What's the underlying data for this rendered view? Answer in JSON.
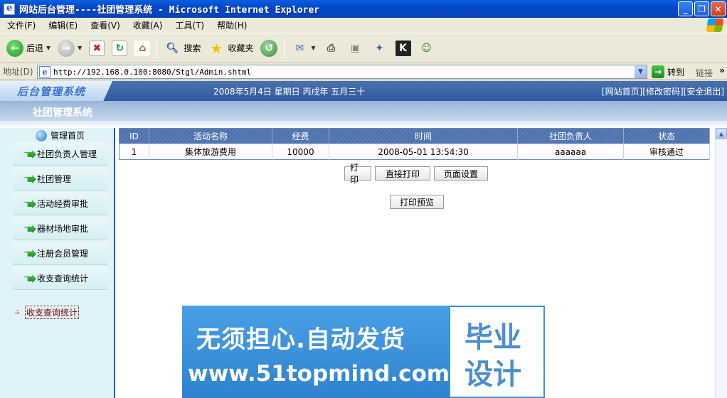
{
  "window": {
    "title": "网站后台管理----社团管理系统 - Microsoft Internet Explorer",
    "min_label": "_",
    "max_label": "❐",
    "close_label": "✕"
  },
  "menu": [
    "文件(F)",
    "编辑(E)",
    "查看(V)",
    "收藏(A)",
    "工具(T)",
    "帮助(H)"
  ],
  "toolbar": {
    "back_label": "后退",
    "search_label": "搜索",
    "favorites_label": "收藏夹"
  },
  "address": {
    "label": "地址(D)",
    "url": "http://192.168.0.100:8080/Stgl/Admin.shtml",
    "go_label": "转到",
    "links_label": "链接"
  },
  "site": {
    "logo": "后台管理系统",
    "date": "2008年5月4日 星期日 丙戌年 五月三十",
    "top_links": "[网站首页][修改密码][安全退出]",
    "subtitle": "社团管理系统"
  },
  "sidebar": {
    "home_label": "管理首页",
    "items": [
      {
        "label": "社团负责人管理"
      },
      {
        "label": "社团管理"
      },
      {
        "label": "活动经费审批"
      },
      {
        "label": "器材场地审批"
      },
      {
        "label": "注册会员管理"
      },
      {
        "label": "收支查询统计"
      }
    ],
    "active_label": "收支查询统计"
  },
  "table": {
    "headers": [
      "ID",
      "活动名称",
      "经费",
      "时间",
      "社团负责人",
      "状态"
    ],
    "rows": [
      [
        "1",
        "集体旅游费用",
        "10000",
        "2008-05-01 13:54:30",
        "aaaaaa",
        "审核通过"
      ]
    ]
  },
  "buttons": {
    "print": "打印",
    "direct_print": "直接打印",
    "page_setup": "页面设置",
    "print_preview": "打印预览"
  },
  "banner": {
    "line1": "无须担心.自动发货",
    "line2": "www.51topmind.com",
    "right1": "毕业",
    "right2": "设计"
  }
}
